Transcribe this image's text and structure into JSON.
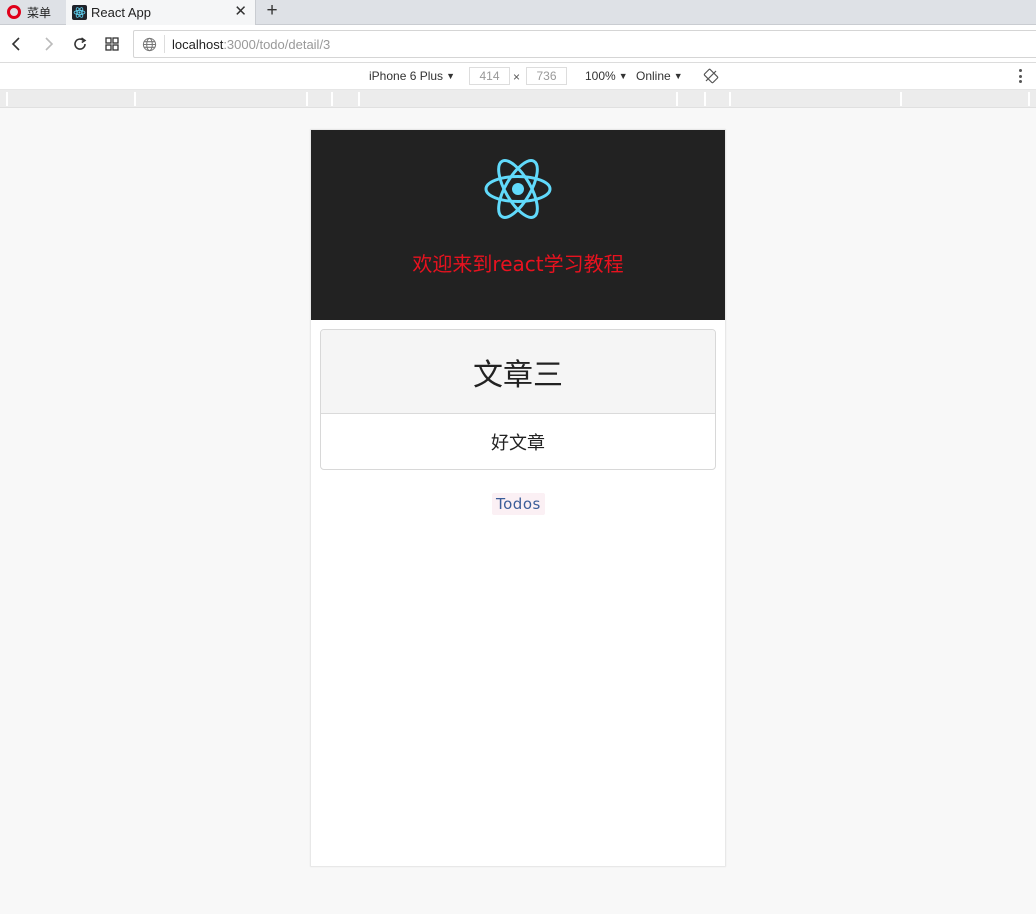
{
  "browser": {
    "menu_label": "菜单",
    "tab": {
      "title": "React App"
    },
    "address": {
      "host": "localhost",
      "path": ":3000/todo/detail/3"
    }
  },
  "devtools": {
    "device": "iPhone 6 Plus",
    "width": "414",
    "height": "736",
    "times": "×",
    "zoom": "100%",
    "network": "Online"
  },
  "app": {
    "header_title": "欢迎来到react学习教程",
    "article": {
      "title": "文章三",
      "body": "好文章"
    },
    "todos_link": "Todos"
  },
  "colors": {
    "header_bg": "#222222",
    "header_title": "#e8121f",
    "react_logo": "#61dafb",
    "link": "#3b5d99"
  }
}
